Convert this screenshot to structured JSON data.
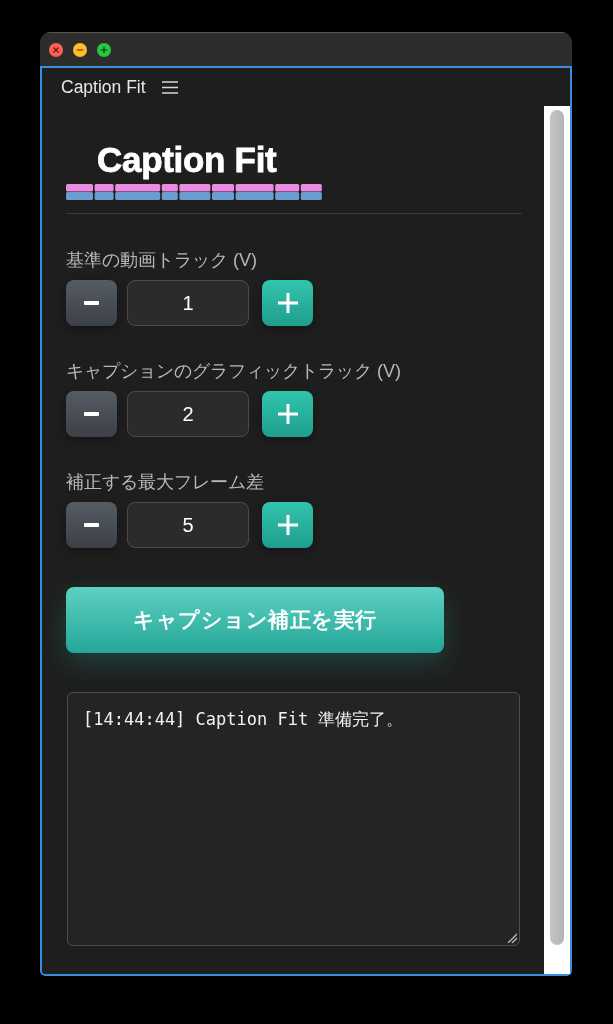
{
  "panel": {
    "title": "Caption Fit"
  },
  "logo": {
    "text": "Caption Fit"
  },
  "steppers": [
    {
      "label": "基準の動画トラック (V)",
      "value": "1"
    },
    {
      "label": "キャプションのグラフィックトラック (V)",
      "value": "2"
    },
    {
      "label": "補正する最大フレーム差",
      "value": "5"
    }
  ],
  "run_button": {
    "label": "キャプション補正を実行"
  },
  "log": {
    "lines": [
      "[14:44:44] Caption Fit 準備完了。"
    ]
  }
}
